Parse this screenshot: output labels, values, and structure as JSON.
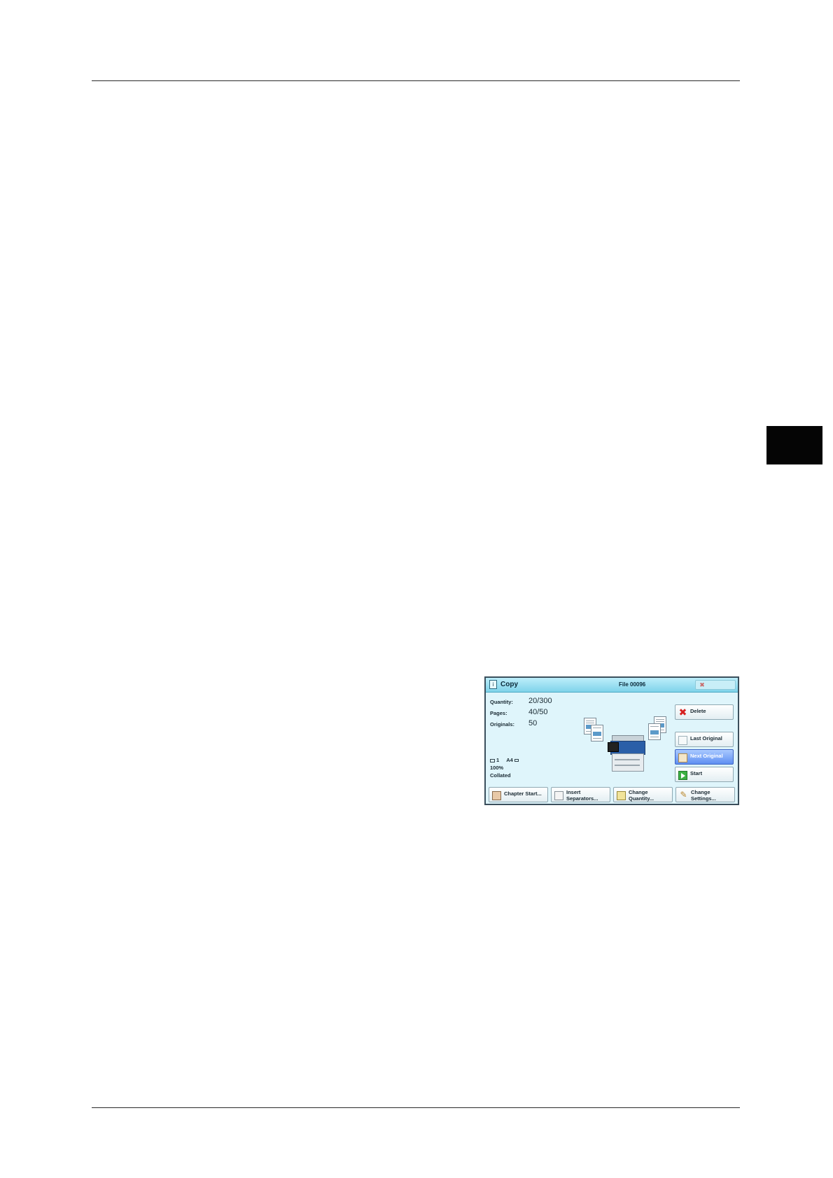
{
  "panel": {
    "title": "Copy",
    "file_name": "File 00096",
    "info": [
      {
        "label": "Quantity:",
        "value": "20/300"
      },
      {
        "label": "Pages:",
        "value": "40/50"
      },
      {
        "label": "Originals:",
        "value": "50"
      }
    ],
    "status": {
      "tray": "1",
      "paper": "A4",
      "zoom": "100%",
      "output": "Collated"
    },
    "side_buttons": {
      "delete": "Delete",
      "last_original": "Last Original",
      "next_original": "Next Original",
      "start": "Start"
    },
    "bottom_buttons": {
      "chapter_start": "Chapter Start...",
      "insert_separators_1": "Insert",
      "insert_separators_2": "Separators...",
      "change_quantity_1": "Change",
      "change_quantity_2": "Quantity...",
      "change_settings_1": "Change",
      "change_settings_2": "Settings..."
    },
    "colors": {
      "background": "#dff5fb",
      "titlebar": "#7fd3ea",
      "active_button": "#5f8ff2",
      "delete_icon": "#d62020",
      "start_icon": "#3cb043"
    }
  }
}
